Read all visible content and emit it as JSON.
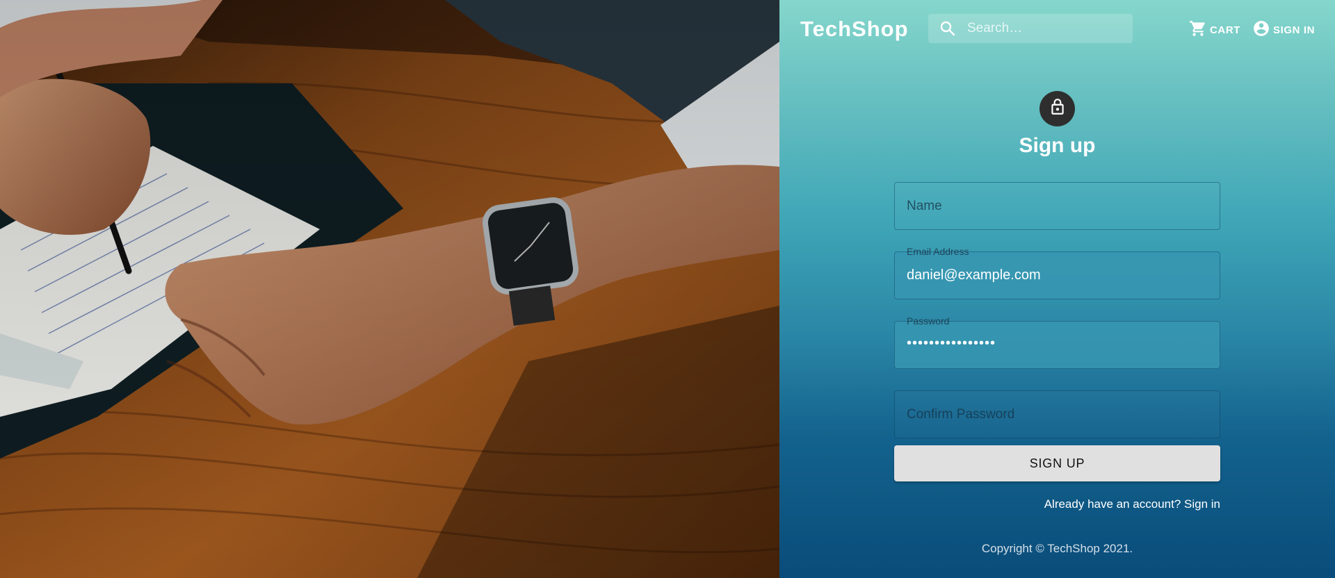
{
  "header": {
    "brand": "TechShop",
    "search_placeholder": "Search…",
    "cart_label": "CART",
    "signin_label": "SIGN IN"
  },
  "form": {
    "title": "Sign up",
    "name_placeholder": "Name",
    "email_label": "Email Address",
    "email_value": "daniel@example.com",
    "password_label": "Password",
    "password_value": "••••••••••••••••",
    "confirm_placeholder": "Confirm Password",
    "submit_label": "SIGN UP",
    "signin_link": "Already have an account? Sign in"
  },
  "footer": {
    "copyright": "Copyright © TechShop 2021."
  },
  "icons": {
    "search": "search-icon",
    "cart": "cart-icon",
    "account": "account-circle-icon",
    "lock": "lock-icon"
  },
  "colors": {
    "panel_top": "#85d7cc",
    "panel_bottom": "#0a4c7a",
    "button_bg": "#e0e0e0",
    "lock_bg": "#2e2e2e"
  }
}
